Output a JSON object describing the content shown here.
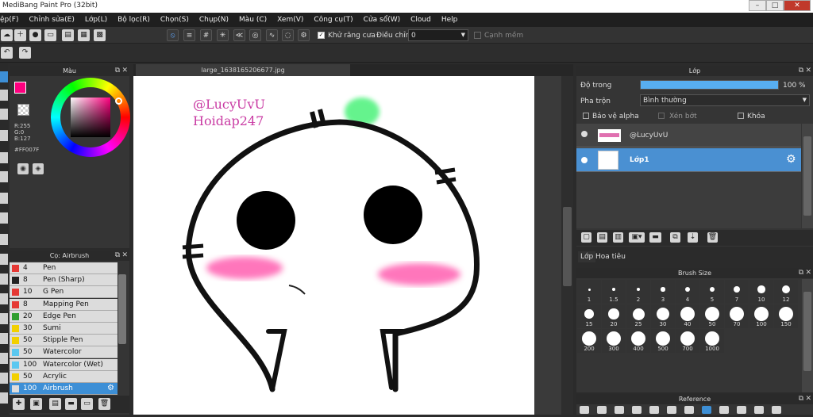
{
  "window": {
    "title": "MediBang Paint Pro (32bit)",
    "min": "–",
    "max": "□",
    "close": "✕"
  },
  "menu": [
    "ệp(F)",
    "Chỉnh sửa(E)",
    "Lớp(L)",
    "Bộ lọc(R)",
    "Chọn(S)",
    "Chụp(N)",
    "Màu (C)",
    "Xem(V)",
    "Công cụ(T)",
    "Cửa sổ(W)",
    "Cloud",
    "Help"
  ],
  "toolbar": {
    "antialias_label": "Khử răng cưa",
    "adjust_label": "Điều chỉnh",
    "adjust_value": "0",
    "snap_label": "Cạnh mềm"
  },
  "color_panel": {
    "title": "Màu",
    "r": "R:255",
    "g": "G:0",
    "b": "B:127",
    "hex": "#FF007F",
    "primary": "#ff007f"
  },
  "brush_panel": {
    "title": "Cọ: Airbrush",
    "brushes": [
      {
        "size": "4",
        "name": "Pen",
        "color": "#e53935"
      },
      {
        "size": "8",
        "name": "Pen (Sharp)",
        "color": "#222222"
      },
      {
        "size": "10",
        "name": "G Pen",
        "color": "#e53935"
      },
      {
        "size": "8",
        "name": "Mapping Pen",
        "color": "#e53935"
      },
      {
        "size": "20",
        "name": "Edge Pen",
        "color": "#2e9e2e"
      },
      {
        "size": "30",
        "name": "Sumi",
        "color": "#f2d000"
      },
      {
        "size": "50",
        "name": "Stipple Pen",
        "color": "#f2d000"
      },
      {
        "size": "50",
        "name": "Watercolor",
        "color": "#5bc8f0"
      },
      {
        "size": "100",
        "name": "Watercolor (Wet)",
        "color": "#5bc8f0"
      },
      {
        "size": "50",
        "name": "Acrylic",
        "color": "#f2d000"
      },
      {
        "size": "100",
        "name": "Airbrush",
        "color": "#dddddd"
      }
    ]
  },
  "document": {
    "tab": "large_1638165206677.jpg",
    "text1": "@LucyUvU",
    "text2": "Hoidap247"
  },
  "layer_panel": {
    "title": "Lớp",
    "opacity_label": "Độ trong",
    "opacity_value": "100 %",
    "opacity": 1.0,
    "blend_label": "Pha trộn",
    "blend_value": "Bình thường",
    "protect_alpha": "Bảo vệ alpha",
    "clip": "Xén bớt",
    "lock": "Khóa",
    "layers": [
      {
        "name": "@LucyUvU",
        "selected": false
      },
      {
        "name": "Lớp1",
        "selected": true
      }
    ],
    "tab1": "Lớp",
    "tab2": "Hoa tiêu"
  },
  "brush_size_panel": {
    "title": "Brush Size",
    "sizes": [
      "1",
      "1.5",
      "2",
      "3",
      "4",
      "5",
      "7",
      "10",
      "12",
      "15",
      "20",
      "25",
      "30",
      "40",
      "50",
      "70",
      "100",
      "150",
      "200",
      "300",
      "400",
      "500",
      "700",
      "1000"
    ]
  },
  "reference_panel": {
    "title": "Reference"
  }
}
